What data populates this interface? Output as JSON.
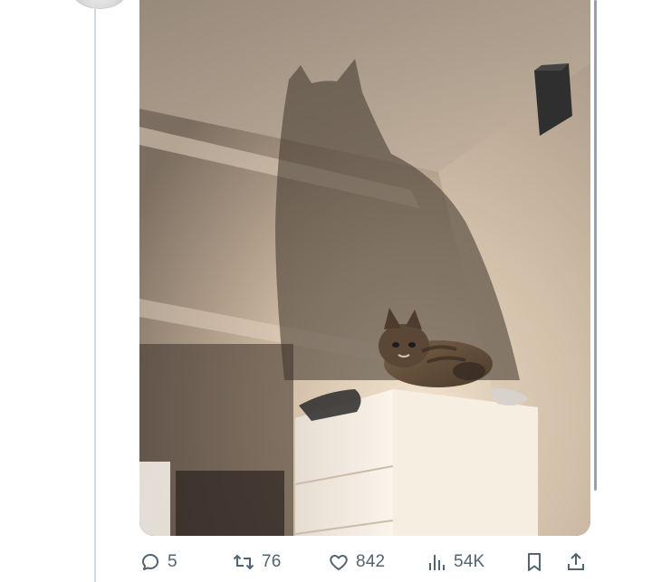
{
  "post": {
    "media": {
      "alt": ""
    },
    "actions": {
      "reply_count": "5",
      "retweet_count": "76",
      "like_count": "842",
      "view_count": "54K"
    },
    "icons": {
      "reply": "speech-bubble-icon",
      "retweet": "retweet-arrows-icon",
      "like": "heart-icon",
      "views": "bar-chart-icon",
      "bookmark": "bookmark-icon",
      "share": "share-upload-icon"
    },
    "colors": {
      "action_text": "#536471",
      "thread_line": "#cfd9de"
    }
  }
}
